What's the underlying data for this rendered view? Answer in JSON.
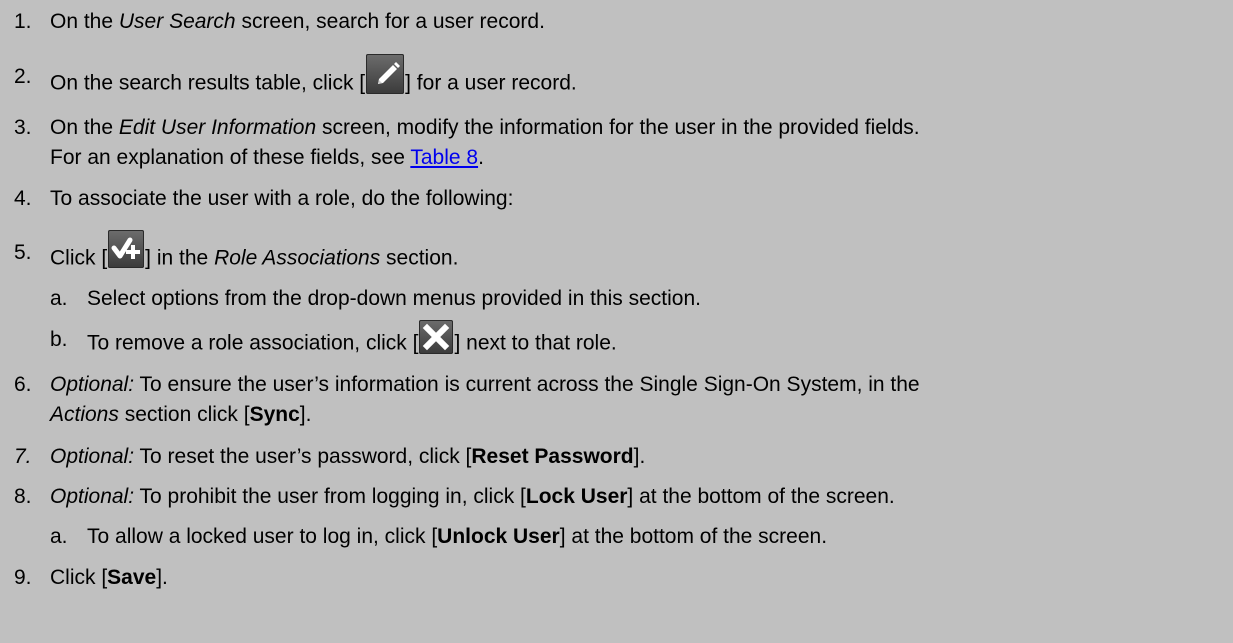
{
  "steps": [
    {
      "num": "1.",
      "pre": "On the ",
      "em": "User Search",
      "post": " screen, search for a user record."
    },
    {
      "num": "2.",
      "pre": "On the search results table, click [",
      "post": "] for a user record.",
      "icon": "pencil-edit-icon"
    },
    {
      "num": "3.",
      "pre": "On the ",
      "em": "Edit User Information",
      "post": " screen, modify the information for the user in the provided fields.",
      "line2_pre": "For an explanation of these fields, see ",
      "link": "Table 8",
      "line2_post": "."
    },
    {
      "num": "4.",
      "text": "To associate the user with a role, do the following:"
    },
    {
      "num": "5.",
      "pre": "Click [",
      "mid": "] in the ",
      "em": "Role Associations",
      "post": " section.",
      "icon": "check-plus-icon"
    },
    {
      "num": "a.",
      "text": "Select options from the drop-down menus provided in this section."
    },
    {
      "num": "b.",
      "pre": "To remove a role association, click [",
      "post": "] next to that role.",
      "icon": "close-x-icon"
    },
    {
      "num": "6.",
      "em": "Optional:",
      "post": " To ensure the user’s information is current across the Single Sign-On System, in the",
      "line2_em": "Actions",
      "line2_pre": " section click [",
      "bold": "Sync",
      "line2_post": "]."
    },
    {
      "num": "7.",
      "em": "Optional:",
      "pre": " To reset the user’s password, click [",
      "bold": "Reset Password",
      "post": "]."
    },
    {
      "num": "8.",
      "em": "Optional:",
      "pre": " To prohibit the user from logging in, click [",
      "bold": "Lock User",
      "post": "] at the bottom of the screen."
    },
    {
      "num": "a.",
      "pre": "To allow a locked user to log in, click [",
      "bold": "Unlock User",
      "post": "] at the bottom of the screen."
    },
    {
      "num": "9.",
      "pre": "Click [",
      "bold": "Save",
      "post": "]."
    }
  ]
}
